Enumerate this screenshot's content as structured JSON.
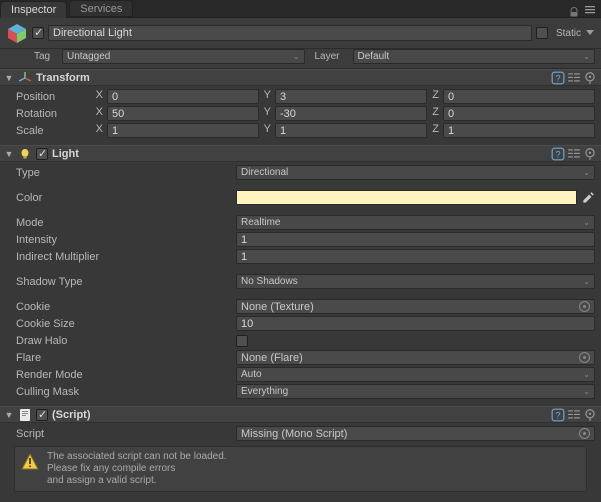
{
  "tabs": {
    "inspector": "Inspector",
    "services": "Services"
  },
  "go": {
    "name": "Directional Light",
    "enabled": true,
    "static_label": "Static",
    "static_checked": false,
    "tag_label": "Tag",
    "tag_value": "Untagged",
    "layer_label": "Layer",
    "layer_value": "Default"
  },
  "transform": {
    "title": "Transform",
    "position_label": "Position",
    "rotation_label": "Rotation",
    "scale_label": "Scale",
    "axis": {
      "x": "X",
      "y": "Y",
      "z": "Z"
    },
    "position": {
      "x": "0",
      "y": "3",
      "z": "0"
    },
    "rotation": {
      "x": "50",
      "y": "-30",
      "z": "0"
    },
    "scale": {
      "x": "1",
      "y": "1",
      "z": "1"
    }
  },
  "light": {
    "title": "Light",
    "enabled": true,
    "type_label": "Type",
    "type_value": "Directional",
    "color_label": "Color",
    "color_value": "#fff3c0",
    "mode_label": "Mode",
    "mode_value": "Realtime",
    "intensity_label": "Intensity",
    "intensity_value": "1",
    "indirect_label": "Indirect Multiplier",
    "indirect_value": "1",
    "shadow_label": "Shadow Type",
    "shadow_value": "No Shadows",
    "cookie_label": "Cookie",
    "cookie_value": "None (Texture)",
    "cookiesize_label": "Cookie Size",
    "cookiesize_value": "10",
    "drawhalo_label": "Draw Halo",
    "drawhalo_checked": false,
    "flare_label": "Flare",
    "flare_value": "None (Flare)",
    "rendermode_label": "Render Mode",
    "rendermode_value": "Auto",
    "culling_label": "Culling Mask",
    "culling_value": "Everything"
  },
  "script": {
    "title": "(Script)",
    "enabled": true,
    "script_label": "Script",
    "script_value": "Missing (Mono Script)",
    "warn_line1": "The associated script can not be loaded.",
    "warn_line2": "Please fix any compile errors",
    "warn_line3": "and assign a valid script."
  }
}
